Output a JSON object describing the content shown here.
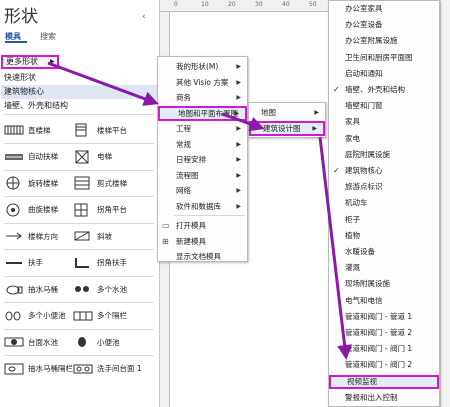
{
  "pane": {
    "title": "形状",
    "tabs": [
      "模具",
      "搜索"
    ],
    "close": "‹",
    "rows": [
      "更多形状",
      "快速形状",
      "建筑物核心",
      "墙壁、外壳和结构"
    ]
  },
  "shapes": [
    {
      "label": "直楼梯",
      "icon": "straight-stair-icon"
    },
    {
      "label": "楼梯平台",
      "icon": "stair-landing-icon"
    },
    {
      "label": "自动扶梯",
      "icon": "escalator-icon"
    },
    {
      "label": "电梯",
      "icon": "elevator-icon"
    },
    {
      "label": "旋转楼梯",
      "icon": "spiral-stair-icon"
    },
    {
      "label": "剪式楼梯",
      "icon": "scissor-stair-icon"
    },
    {
      "label": "曲旋楼梯",
      "icon": "curved-stair-icon"
    },
    {
      "label": "拐角平台",
      "icon": "corner-landing-icon"
    },
    {
      "label": "楼梯方向",
      "icon": "stair-direction-icon"
    },
    {
      "label": "斜坡",
      "icon": "ramp-icon"
    },
    {
      "label": "扶手",
      "icon": "handrail-icon"
    },
    {
      "label": "拐角扶手",
      "icon": "corner-handrail-icon"
    },
    {
      "label": "抽水马桶",
      "icon": "toilet-icon"
    },
    {
      "label": "多个水池",
      "icon": "multiple-sinks-icon"
    },
    {
      "label": "多个小便池",
      "icon": "multiple-urinals-icon"
    },
    {
      "label": "多个隔栏",
      "icon": "multiple-partitions-icon"
    },
    {
      "label": "台面水池",
      "icon": "counter-sink-icon"
    },
    {
      "label": "小便池",
      "icon": "urinal-icon"
    },
    {
      "label": "抽水马桶隔栏",
      "icon": "toilet-stall-icon"
    },
    {
      "label": "洗手间台面 1",
      "icon": "lavatory-counter-icon"
    }
  ],
  "ruler": [
    "0",
    "10",
    "20",
    "30",
    "40",
    "50",
    "60"
  ],
  "menu1": {
    "items": [
      {
        "label": "我的形状(M)",
        "sub": true
      },
      {
        "label": "其他 Visio 方案",
        "sub": true
      },
      {
        "label": "商务",
        "sub": true
      },
      {
        "label": "地图和平面布置图",
        "sub": true,
        "highlight": true
      },
      {
        "label": "工程",
        "sub": true
      },
      {
        "label": "常规",
        "sub": true
      },
      {
        "label": "日程安排",
        "sub": true
      },
      {
        "label": "流程图",
        "sub": true
      },
      {
        "label": "网络",
        "sub": true
      },
      {
        "label": "软件和数据库",
        "sub": true
      },
      {
        "label": "打开模具",
        "sub": false,
        "icon": "open-stencil-icon"
      },
      {
        "label": "新建模具",
        "sub": false,
        "icon": "new-stencil-icon"
      },
      {
        "label": "显示文档模具",
        "sub": false
      }
    ]
  },
  "menu2": {
    "items": [
      {
        "label": "地图",
        "highlight": false
      },
      {
        "label": "建筑设计图",
        "highlight": true
      }
    ]
  },
  "menu3": {
    "items": [
      {
        "label": "办公室家具",
        "checked": false
      },
      {
        "label": "办公室设备",
        "checked": false
      },
      {
        "label": "办公室附属设施",
        "checked": false
      },
      {
        "label": "卫生间和厨房平面图",
        "checked": false
      },
      {
        "label": "启动和通知",
        "checked": false
      },
      {
        "label": "墙壁、外壳和结构",
        "checked": true
      },
      {
        "label": "墙壁和门窗",
        "checked": false
      },
      {
        "label": "家具",
        "checked": false
      },
      {
        "label": "家电",
        "checked": false
      },
      {
        "label": "庭院附属设施",
        "checked": false
      },
      {
        "label": "建筑物核心",
        "checked": true
      },
      {
        "label": "旅游点标识",
        "checked": false
      },
      {
        "label": "机动车",
        "checked": false
      },
      {
        "label": "柜子",
        "checked": false
      },
      {
        "label": "植物",
        "checked": false
      },
      {
        "label": "水暖设备",
        "checked": false
      },
      {
        "label": "灌溉",
        "checked": false
      },
      {
        "label": "现场附属设施",
        "checked": false
      },
      {
        "label": "电气和电信",
        "checked": false
      },
      {
        "label": "管道和阀门 - 管道 1",
        "checked": false
      },
      {
        "label": "管道和阀门 - 管道 2",
        "checked": false
      },
      {
        "label": "管道和阀门 - 阀门 1",
        "checked": false
      },
      {
        "label": "管道和阀门 - 阀门 2",
        "checked": false
      },
      {
        "label": "视频监视",
        "checked": false,
        "highlight": true
      },
      {
        "label": "警报和出入控制",
        "checked": false
      }
    ]
  },
  "colors": {
    "highlight_border": "#d01ad0",
    "arrow": "#8a1aa8",
    "selection": "#e4ecf7"
  }
}
